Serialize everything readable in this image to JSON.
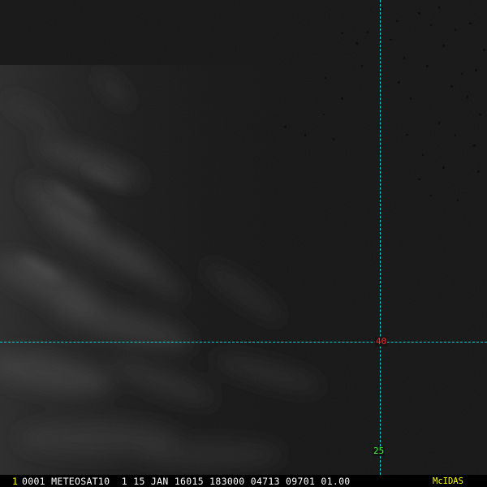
{
  "image": {
    "description_type": "satellite-visible-imagery",
    "background_color": "#141414",
    "cloud_color": "#4a4a4a"
  },
  "grid": {
    "line_color": "#00d4d4",
    "lat_label": "40",
    "lat_label_color": "#ff2a2a",
    "lon_label": "25",
    "lon_label_color": "#33ff33"
  },
  "status_bar": {
    "frame_number": "1",
    "frame_number_color": "#ffff00",
    "header_text": "0001 METEOSAT10  1 15 JAN 16015 183000 04713 09701 01.00",
    "header_color": "#ffffff",
    "logo_text": "McIDAS",
    "logo_color": "#ffff00"
  }
}
